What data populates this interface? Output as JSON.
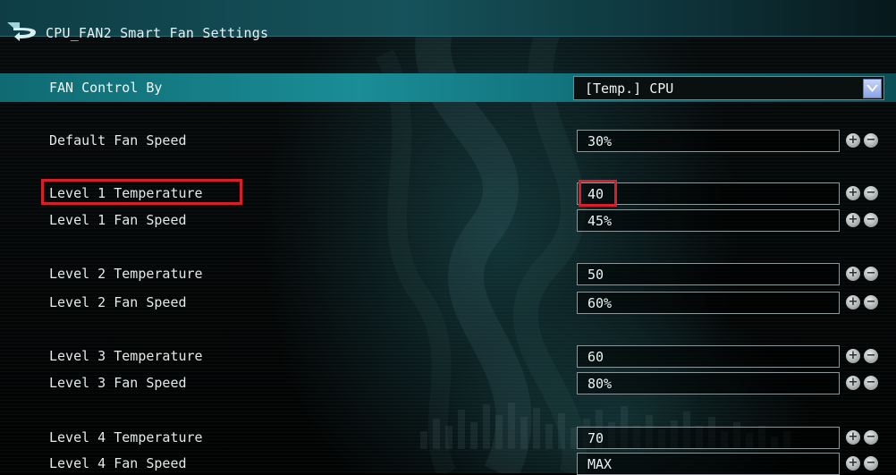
{
  "header": {
    "title": "CPU_FAN2 Smart Fan Settings"
  },
  "fan_control": {
    "label": "FAN Control By",
    "value": "[Temp.] CPU"
  },
  "settings": [
    {
      "label": "Default Fan Speed",
      "value": "30%"
    },
    {
      "label": "Level 1 Temperature",
      "value": "40"
    },
    {
      "label": "Level 1 Fan Speed",
      "value": "45%"
    },
    {
      "label": "Level 2 Temperature",
      "value": "50"
    },
    {
      "label": "Level 2 Fan Speed",
      "value": "60%"
    },
    {
      "label": "Level 3 Temperature",
      "value": "60"
    },
    {
      "label": "Level 3 Fan Speed",
      "value": "80%"
    },
    {
      "label": "Level 4 Temperature",
      "value": "70"
    },
    {
      "label": "Level 4 Fan Speed",
      "value": "MAX"
    }
  ],
  "stepper": {
    "plus": "+",
    "minus": "−"
  },
  "icons": {
    "back": "back-arrow-icon",
    "dropdown": "chevron-down-icon",
    "plus": "plus-circle-icon",
    "minus": "minus-circle-icon"
  },
  "colors": {
    "accent": "#1a8d96",
    "highlight": "#d81e28",
    "titlebar": "#16525b"
  }
}
